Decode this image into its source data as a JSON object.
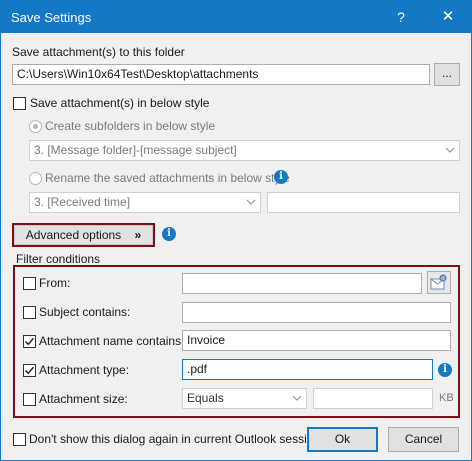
{
  "window": {
    "title": "Save Settings",
    "help_glyph": "?",
    "close_glyph": "✕"
  },
  "folder": {
    "label": "Save attachment(s) to this folder",
    "path": "C:\\Users\\Win10x64Test\\Desktop\\attachments",
    "browse_label": "..."
  },
  "style": {
    "checkbox_label": "Save attachment(s) in below style",
    "checked": false,
    "subfolder_label": "Create subfolders in below style",
    "subfolder_value": "3. [Message folder]-[message subject]",
    "rename_label": "Rename the saved attachments in below style",
    "rename_value": "3. [Received time]",
    "rename_extra": ""
  },
  "advanced_button": {
    "label": "Advanced options",
    "glyph": "»"
  },
  "filter": {
    "group_label": "Filter conditions",
    "rows": [
      {
        "label": "From:",
        "checked": false,
        "value": ""
      },
      {
        "label": "Subject contains:",
        "checked": false,
        "value": ""
      },
      {
        "label": "Attachment name contains:",
        "checked": true,
        "value": "Invoice"
      },
      {
        "label": "Attachment type:",
        "checked": true,
        "value": ".pdf"
      },
      {
        "label": "Attachment size:",
        "checked": false,
        "value": ""
      }
    ],
    "size_operator": "Equals",
    "size_unit": "KB"
  },
  "footer": {
    "dont_show_label": "Don't show this dialog again in current Outlook session.",
    "ok_label": "Ok",
    "cancel_label": "Cancel"
  },
  "colors": {
    "title_bar": "#1479c4",
    "highlight_frame": "#7b1114",
    "info": "#1479c4"
  }
}
